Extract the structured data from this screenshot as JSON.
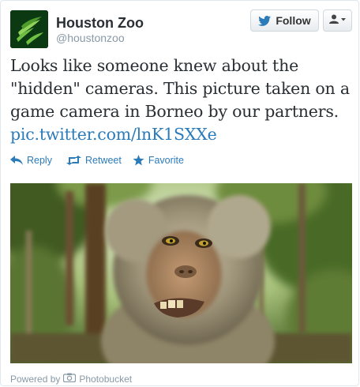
{
  "user": {
    "display_name": "Houston Zoo",
    "handle": "@houstonzoo"
  },
  "header": {
    "follow_label": "Follow",
    "avatar_icon": "houston-zoo-logo",
    "follow_icon": "twitter-bird-icon",
    "menu_icon": "user-dropdown-icon"
  },
  "tweet": {
    "line1": "Looks like someone knew about the",
    "line2": "\"hidden\" cameras. This picture taken on a",
    "line3": "game camera in Borneo by our partners.",
    "link": "pic.twitter.com/lnK1SXXe"
  },
  "actions": {
    "reply": "Reply",
    "retweet": "Retweet",
    "favorite": "Favorite"
  },
  "media": {
    "subject": "macaque monkey close-up in forest"
  },
  "footer": {
    "powered_by": "Powered by",
    "provider": "Photobucket"
  },
  "colors": {
    "link": "#2b7bb9",
    "text": "#292f33",
    "muted": "#8899a6",
    "avatar_bg": "#0b3a12"
  }
}
